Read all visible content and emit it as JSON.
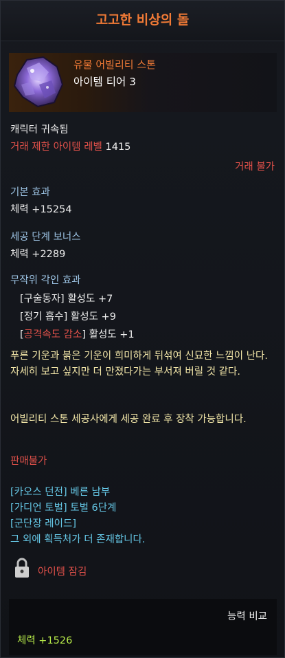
{
  "title": "고고한 비상의 돌",
  "header": {
    "rarity_type": "유물 어빌리티 스톤",
    "tier": "아이템 티어 3",
    "icon": "purple-crystal-stone-icon"
  },
  "bind": "캐릭터 귀속됨",
  "trade_level": {
    "label": "거래 제한 아이템 레벨",
    "value": "1415"
  },
  "trade_status": "거래 불가",
  "base_effect": {
    "heading": "기본 효과",
    "value": "체력 +15254"
  },
  "cut_bonus": {
    "heading": "세공 단계 보너스",
    "value": "체력 +2289"
  },
  "engraving": {
    "heading": "무작위 각인 효과",
    "items": [
      {
        "name": "구술동자",
        "value": "활성도 +7"
      },
      {
        "name": "정기 흡수",
        "value": "활성도 +9"
      },
      {
        "name": "공격속도 감소",
        "value": "활성도 +1"
      }
    ]
  },
  "flavor_text": "푸른 기운과 붉은 기운이 희미하게 뒤섞여 신묘한 느낌이 난다. 자세히 보고 싶지만 더 만졌다가는 부서져 버릴 것 같다.",
  "usage_text": "어빌리티 스톤 세공사에게 세공 완료 후 장착 가능합니다.",
  "sell_status": "판매불가",
  "sources": [
    {
      "tag": "카오스 던전",
      "name": "베른 남부"
    },
    {
      "tag": "가디언 토벌",
      "name": "토벌 6단계"
    },
    {
      "tag": "군단장 레이드",
      "name": ""
    }
  ],
  "sources_more": "그 외에 획득처가 더 존재합니다.",
  "lock": {
    "label": "아이템 잠김",
    "icon": "padlock-icon"
  },
  "compare": {
    "heading": "능력 비교",
    "value": "체력 +1526"
  },
  "colors": {
    "title": "#f07a36",
    "red": "#e2514a",
    "heading_blue": "#9ec5e6",
    "flavor_yellow": "#f2e6a8",
    "source_cyan": "#66c9e8",
    "compare_green": "#b8ec4a"
  }
}
